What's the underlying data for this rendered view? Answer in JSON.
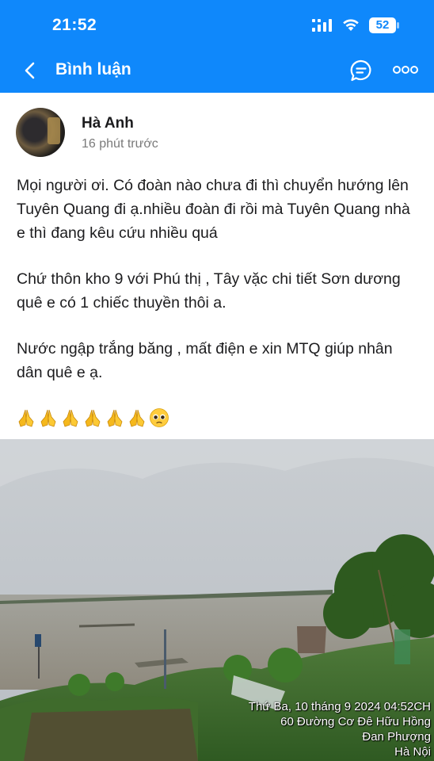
{
  "status_bar": {
    "time": "21:52",
    "battery": "52"
  },
  "nav": {
    "title": "Bình luận"
  },
  "post": {
    "author": "Hà Anh",
    "time_ago": "16 phút trước",
    "paragraphs": [
      "Mọi người ơi. Có đoàn nào chưa đi thì chuyển hướng lên Tuyên Quang đi ạ.nhiều đoàn đi rồi mà Tuyên Quang nhà e thì đang kêu cứu nhiều quá",
      "Chứ thôn kho 9 với Phú thị , Tây vặc chi tiết Sơn dương quê e có 1 chiếc thuyền thôi a.",
      "Nước ngập trắng băng , mất điện e xin MTQ giúp nhân dân quê e ạ."
    ],
    "emoji": [
      "folded-hands",
      "folded-hands",
      "folded-hands",
      "folded-hands",
      "folded-hands",
      "folded-hands",
      "pleading-face"
    ]
  },
  "photo": {
    "caption_lines": [
      "Thứ Ba, 10 tháng 9 2024 04:52CH",
      "60 Đường Cơ Đê Hữu Hồng",
      "Đan Phượng",
      "Hà Nội"
    ]
  },
  "colors": {
    "header": "#0f88fb",
    "text": "#1c1c1e",
    "muted": "#7a7a7a"
  }
}
